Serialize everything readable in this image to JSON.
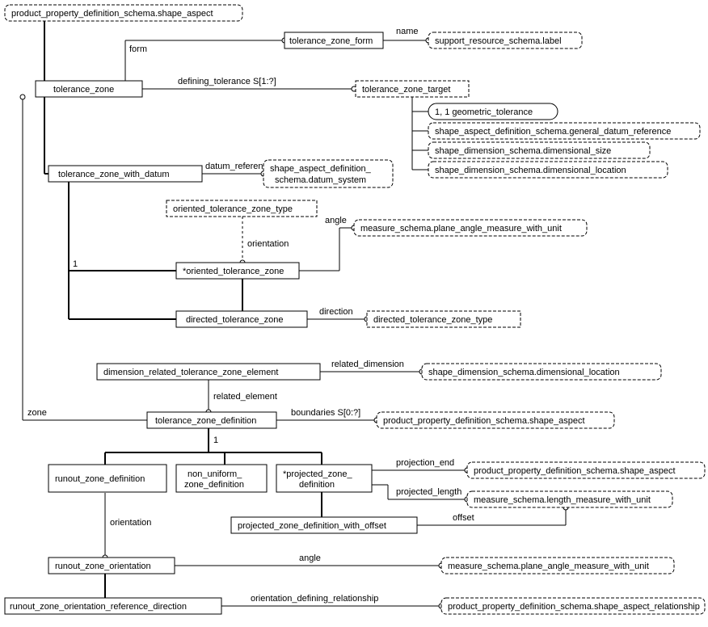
{
  "nodes": {
    "shape_aspect": "product_property_definition_schema.shape_aspect",
    "tolerance_zone_form": "tolerance_zone_form",
    "support_label": "support_resource_schema.label",
    "tolerance_zone": "tolerance_zone",
    "tolerance_zone_target": "tolerance_zone_target",
    "geometric_tolerance": "1, 1 geometric_tolerance",
    "general_datum_ref": "shape_aspect_definition_schema.general_datum_reference",
    "dimensional_size": "shape_dimension_schema.dimensional_size",
    "dimensional_location": "shape_dimension_schema.dimensional_location",
    "tolerance_zone_with_datum": "tolerance_zone_with_datum",
    "datum_system": "shape_aspect_definition_\nschema.datum_system",
    "oriented_tolerance_zone_type": "oriented_tolerance_zone_type",
    "plane_angle_measure": "measure_schema.plane_angle_measure_with_unit",
    "oriented_tolerance_zone": "*oriented_tolerance_zone",
    "directed_tolerance_zone": "directed_tolerance_zone",
    "directed_tolerance_zone_type": "directed_tolerance_zone_type",
    "dim_related_tz_element": "dimension_related_tolerance_zone_element",
    "dimensional_location2": "shape_dimension_schema.dimensional_location",
    "tolerance_zone_definition": "tolerance_zone_definition",
    "shape_aspect2": "product_property_definition_schema.shape_aspect",
    "runout_zone_definition": "runout_zone_definition",
    "non_uniform_zone_def": "non_uniform_\nzone_definition",
    "projected_zone_def": "*projected_zone_\ndefinition",
    "shape_aspect3": "product_property_definition_schema.shape_aspect",
    "length_measure": "measure_schema.length_measure_with_unit",
    "projected_zone_def_offset": "projected_zone_definition_with_offset",
    "runout_zone_orientation": "runout_zone_orientation",
    "plane_angle_measure2": "measure_schema.plane_angle_measure_with_unit",
    "runout_zone_orientation_ref_dir": "runout_zone_orientation_reference_direction",
    "shape_aspect_relationship": "product_property_definition_schema.shape_aspect_relationship"
  },
  "labels": {
    "name": "name",
    "form": "form",
    "defining_tolerance": "defining_tolerance S[1:?]",
    "datum_reference": "datum_reference",
    "angle": "angle",
    "orientation": "orientation",
    "one": "1",
    "direction": "direction",
    "related_dimension": "related_dimension",
    "related_element": "related_element",
    "zone": "zone",
    "boundaries": "boundaries S[0:?]",
    "projection_end": "projection_end",
    "projected_length": "projected_length",
    "offset": "offset",
    "angle2": "angle",
    "orientation2": "orientation",
    "orientation_defining_relationship": "orientation_defining_relationship"
  }
}
